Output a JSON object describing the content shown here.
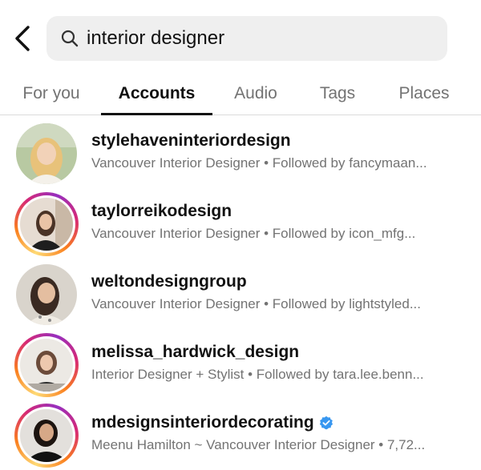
{
  "search": {
    "query": "interior designer"
  },
  "tabs": [
    {
      "label": "For you"
    },
    {
      "label": "Accounts"
    },
    {
      "label": "Audio"
    },
    {
      "label": "Tags"
    },
    {
      "label": "Places"
    }
  ],
  "results": [
    {
      "username": "stylehaveninteriordesign",
      "subtitle": "Vancouver Interior Designer • Followed by fancymaan..."
    },
    {
      "username": "taylorreikodesign",
      "subtitle": "Vancouver Interior Designer • Followed by icon_mfg..."
    },
    {
      "username": "weltondesigngroup",
      "subtitle": "Vancouver Interior Designer • Followed by lightstyled..."
    },
    {
      "username": "melissa_hardwick_design",
      "subtitle": "Interior Designer + Stylist • Followed by tara.lee.benn..."
    },
    {
      "username": "mdesignsinteriordecorating",
      "subtitle": "Meenu Hamilton ~ Vancouver Interior Designer • 7,72..."
    }
  ],
  "colors": {
    "accent_verified": "#3897f0",
    "secondary_text": "#737373"
  }
}
